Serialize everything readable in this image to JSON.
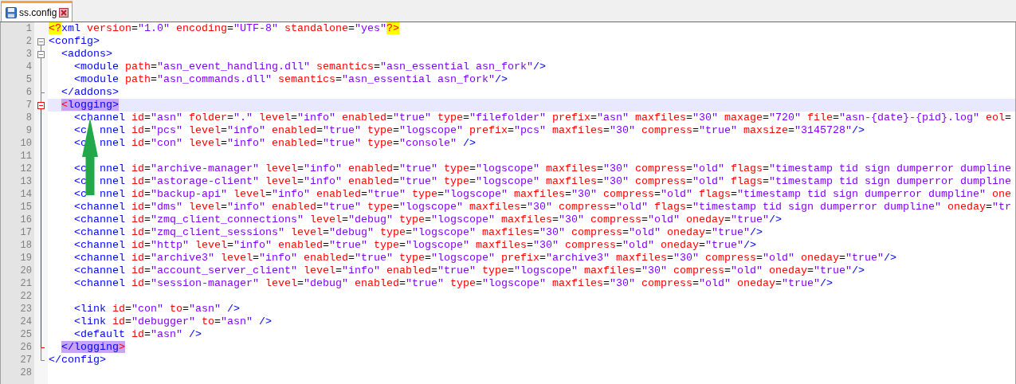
{
  "tabs": [
    {
      "label": "ss.config",
      "selected": true
    }
  ],
  "editor": {
    "lines": [
      {
        "number": "1",
        "kind": "plain",
        "text": "<?xml version=\"1.0\" encoding=\"UTF-8\" standalone=\"yes\"?>",
        "current": false
      },
      {
        "number": "2",
        "kind": "fold_open",
        "text": "<config>",
        "current": false
      },
      {
        "number": "3",
        "kind": "fold_open",
        "text": "  <addons>",
        "current": false
      },
      {
        "number": "4",
        "kind": "plain",
        "text": "    <module path=\"asn_event_handling.dll\" semantics=\"asn_essential asn_fork\"/>",
        "current": false
      },
      {
        "number": "5",
        "kind": "plain",
        "text": "    <module path=\"asn_commands.dll\" semantics=\"asn_essential asn_fork\"/>",
        "current": false
      },
      {
        "number": "6",
        "kind": "fold_end",
        "text": "  </addons>",
        "current": false
      },
      {
        "number": "7",
        "kind": "fold_open",
        "text": "  <logging>",
        "current": true,
        "tag_highlighted": true
      },
      {
        "number": "8",
        "kind": "plain",
        "text": "    <channel id=\"asn\" folder=\".\" level=\"info\" enabled=\"true\" type=\"filefolder\" prefix=\"asn\" maxfiles=\"30\" maxage=\"720\" file=\"asn-{date}-{pid}.log\" eol=",
        "current": false
      },
      {
        "number": "9",
        "kind": "plain",
        "text": "    <c  nnel id=\"pcs\" level=\"info\" enabled=\"true\" type=\"logscope\" prefix=\"pcs\" maxfiles=\"30\" compress=\"true\" maxsize=\"3145728\"/>",
        "current": false
      },
      {
        "number": "10",
        "kind": "plain",
        "text": "    <c  nnel id=\"con\" level=\"info\" enabled=\"true\" type=\"console\" />",
        "current": false
      },
      {
        "number": "11",
        "kind": "plain",
        "current": false
      },
      {
        "number": "12",
        "kind": "plain",
        "text": "    <c  nnel id=\"archive-manager\" level=\"info\" enabled=\"true\" type=\"logscope\" maxfiles=\"30\" compress=\"old\" flags=\"timestamp tid sign dumperror dumpline",
        "current": false
      },
      {
        "number": "13",
        "kind": "plain",
        "text": "    <c  nnel id=\"astorage-client\" level=\"info\" enabled=\"true\" type=\"logscope\" maxfiles=\"30\" compress=\"old\" flags=\"timestamp tid sign dumperror dumpline",
        "current": false
      },
      {
        "number": "14",
        "kind": "plain",
        "text": "    <c  nnel id=\"backup-api\" level=\"info\" enabled=\"true\" type=\"logscope\" maxfiles=\"30\" compress=\"old\" flags=\"timestamp tid sign dumperror dumpline\" one",
        "current": false
      },
      {
        "number": "15",
        "kind": "plain",
        "text": "    <channel id=\"dms\" level=\"info\" enabled=\"true\" type=\"logscope\" maxfiles=\"30\" compress=\"old\" flags=\"timestamp tid sign dumperror dumpline\" oneday=\"tr",
        "current": false
      },
      {
        "number": "16",
        "kind": "plain",
        "text": "    <channel id=\"zmq_client_connections\" level=\"debug\" type=\"logscope\" maxfiles=\"30\" compress=\"old\" oneday=\"true\"/>",
        "current": false
      },
      {
        "number": "17",
        "kind": "plain",
        "text": "    <channel id=\"zmq_client_sessions\" level=\"debug\" type=\"logscope\" maxfiles=\"30\" compress=\"old\" oneday=\"true\"/>",
        "current": false
      },
      {
        "number": "18",
        "kind": "plain",
        "text": "    <channel id=\"http\" level=\"info\" enabled=\"true\" type=\"logscope\" maxfiles=\"30\" compress=\"old\" oneday=\"true\"/>",
        "current": false
      },
      {
        "number": "19",
        "kind": "plain",
        "text": "    <channel id=\"archive3\" level=\"info\" enabled=\"true\" type=\"logscope\" prefix=\"archive3\" maxfiles=\"30\" compress=\"old\" oneday=\"true\"/>",
        "current": false
      },
      {
        "number": "20",
        "kind": "plain",
        "text": "    <channel id=\"account_server_client\" level=\"info\" enabled=\"true\" type=\"logscope\" maxfiles=\"30\" compress=\"old\" oneday=\"true\"/>",
        "current": false
      },
      {
        "number": "21",
        "kind": "plain",
        "text": "    <channel id=\"session-manager\" level=\"debug\" enabled=\"true\" type=\"logscope\" maxfiles=\"30\" compress=\"old\" oneday=\"true\"/>",
        "current": false
      },
      {
        "number": "22",
        "kind": "plain",
        "current": false
      },
      {
        "number": "23",
        "kind": "plain",
        "text": "    <link id=\"con\" to=\"asn\" />",
        "current": false
      },
      {
        "number": "24",
        "kind": "plain",
        "text": "    <link id=\"debugger\" to=\"asn\" />",
        "current": false
      },
      {
        "number": "25",
        "kind": "plain",
        "text": "    <default id=\"asn\" />",
        "current": false
      },
      {
        "number": "26",
        "kind": "fold_end",
        "text": "  </logging>",
        "current": false,
        "tag_highlighted": true
      },
      {
        "number": "27",
        "kind": "fold_end",
        "text": "</config>",
        "current": false
      },
      {
        "number": "28",
        "kind": "plain",
        "current": false
      }
    ]
  }
}
